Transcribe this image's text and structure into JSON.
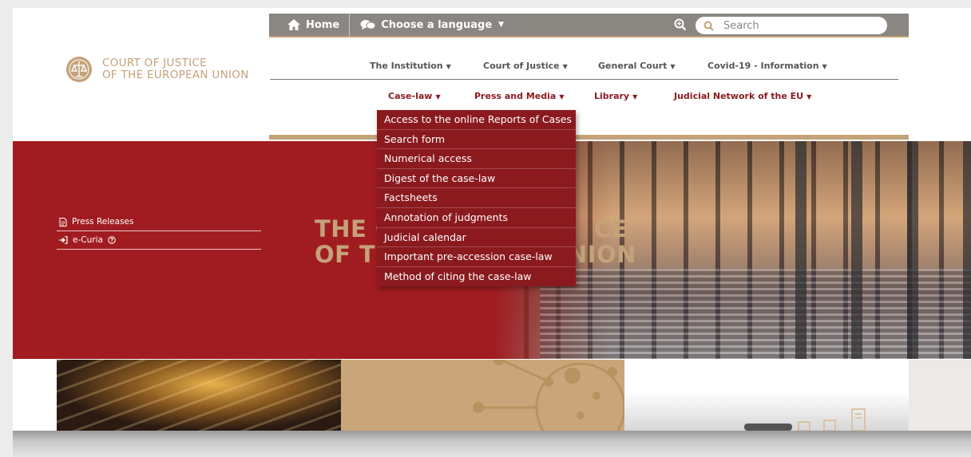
{
  "topbar": {
    "home_label": "Home",
    "language_label": "Choose a language",
    "search_placeholder": "Search"
  },
  "logo": {
    "line1": "COURT OF JUSTICE",
    "line2": "OF THE EUROPEAN UNION"
  },
  "nav": {
    "row1": [
      {
        "label": "The Institution"
      },
      {
        "label": "Court of Justice"
      },
      {
        "label": "General Court"
      },
      {
        "label": "Covid-19 - Information"
      }
    ],
    "row2": [
      {
        "label": "Case-law"
      },
      {
        "label": "Press and Media"
      },
      {
        "label": "Library"
      },
      {
        "label": "Judicial Network of the EU"
      }
    ]
  },
  "dropdown": {
    "items": [
      "Access to the online Reports of Cases",
      "Search form",
      "Numerical access",
      "Digest of the case-law",
      "Factsheets",
      "Annotation of judgments",
      "Judicial calendar",
      "Important pre-accession case-law",
      "Method of citing the case-law"
    ]
  },
  "hero": {
    "title_line1": "THE C",
    "title_line1_end": "CE",
    "title_line2": "OF TI",
    "title_line2_end": "JNION"
  },
  "side_links": {
    "press_releases": "Press Releases",
    "ecuria": "e-Curia"
  },
  "colors": {
    "brand_red": "#8b1a1f",
    "hero_red": "#a11c20",
    "gold": "#c4a27a",
    "topbar_grey": "#8a8782"
  }
}
